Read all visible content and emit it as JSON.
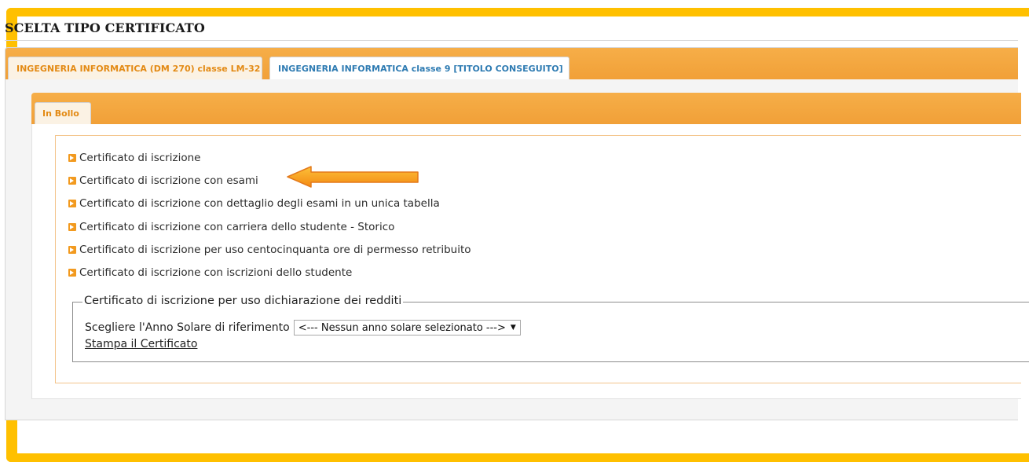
{
  "page": {
    "title": "SCELTA TIPO CERTIFICATO"
  },
  "outer_tabs": [
    {
      "label": "INGEGNERIA INFORMATICA (DM 270) classe LM-32",
      "active": true
    },
    {
      "label": "INGEGNERIA INFORMATICA classe 9 [TITOLO CONSEGUITO]",
      "active": false
    }
  ],
  "inner_tabs": [
    {
      "label": "In Bollo",
      "active": true
    }
  ],
  "certificates": [
    {
      "label": "Certificato di iscrizione"
    },
    {
      "label": "Certificato di iscrizione con esami",
      "highlighted": true
    },
    {
      "label": "Certificato di iscrizione con dettaglio degli esami in un unica tabella"
    },
    {
      "label": "Certificato di iscrizione con carriera dello studente - Storico"
    },
    {
      "label": "Certificato di iscrizione per uso centocinquanta ore di permesso retribuito"
    },
    {
      "label": "Certificato di iscrizione con iscrizioni dello studente"
    }
  ],
  "income_section": {
    "legend": "Certificato di iscrizione per uso dichiarazione dei redditi",
    "year_label": "Scegliere l'Anno Solare di riferimento",
    "year_select_value": "<--- Nessun anno solare selezionato --->",
    "print_link": "Stampa il Certificato"
  },
  "colors": {
    "frame_border": "#FFC000",
    "tab_bar": "#F3A53F",
    "active_tab_text": "#E38A14",
    "inactive_tab_text": "#2E7BB2",
    "list_bullet": "#F29A1F",
    "callout_arrow": "#F7941D"
  },
  "icons": {
    "list_bullet": "orange-arrow-bullet-icon",
    "callout": "left-arrow-callout-icon"
  }
}
